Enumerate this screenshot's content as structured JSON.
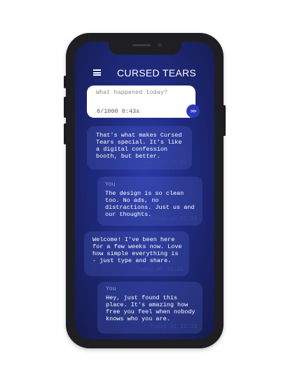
{
  "app": {
    "title": "CURSED TEARS"
  },
  "composer": {
    "placeholder": "What happened today?",
    "counter": "0/1000 0:43s",
    "send_glyph": ">>"
  },
  "messages": [
    {
      "author": "",
      "text": "That's what makes Cursed Tears special. It's like a digital confession booth, but better.",
      "time": "Today at 12:33"
    },
    {
      "author": "You",
      "text": "The design is so clean too. No ads, no distractions. Just us and our thoughts.",
      "time": "Today at 12:32"
    },
    {
      "author": "",
      "text": "Welcome! I've been here for a few weeks now. Love how simple everything is - just type and share.",
      "time": "Today at 12:32"
    },
    {
      "author": "You",
      "text": "Hey, just found this place. It's amazing how free you feel when nobody knows who you are.",
      "time": "Today at 12:31"
    }
  ],
  "colors": {
    "screen_background": "#1f2a7e",
    "send_button": "#2e39b8",
    "bubble": "#4a5ac4",
    "timestamp": "#3d4a9e"
  },
  "icons": {
    "menu": "hamburger-menu-icon",
    "send": "send-icon"
  }
}
